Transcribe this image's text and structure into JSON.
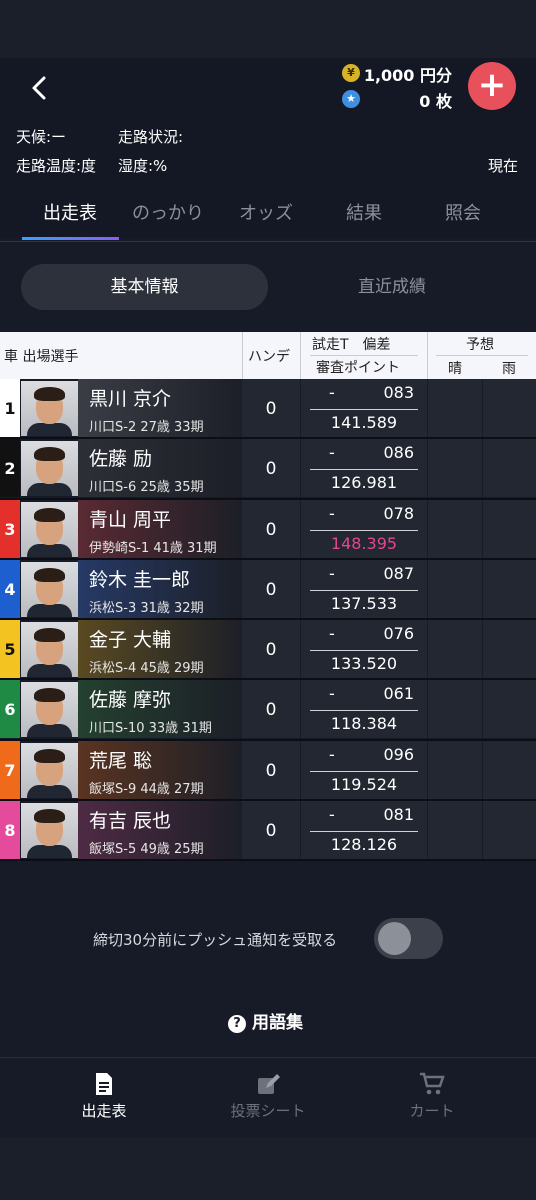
{
  "header": {
    "coin_symbol": "¥",
    "coin_text": "1,000 円分",
    "ticket_text": "0 枚",
    "add_label": "+",
    "back_label": "‹"
  },
  "info": {
    "weather": "天候:ー",
    "track_state": "走路状況:",
    "track_temp": "走路温度:度",
    "humidity": "湿度:%",
    "now": "現在"
  },
  "tabs": [
    "出走表",
    "のっかり",
    "オッズ",
    "結果",
    "照会"
  ],
  "segments": [
    "基本情報",
    "直近成績"
  ],
  "table": {
    "col_rider": "車 出場選手",
    "col_hande": "ハンデ",
    "col_trial_top": "試走T　偏差",
    "col_trial_bottom": "審査ポイント",
    "col_pred": "予想",
    "col_pred_sunny": "晴",
    "col_pred_rain": "雨",
    "rows": [
      {
        "no": "1",
        "name": "黒川 京介",
        "meta": "川口S-2 27歳 33期",
        "hande": "0",
        "trial": "-",
        "dev": "083",
        "points": "141.589",
        "points_color": "#ffffff"
      },
      {
        "no": "2",
        "name": "佐藤 励",
        "meta": "川口S-6 25歳 35期",
        "hande": "0",
        "trial": "-",
        "dev": "086",
        "points": "126.981",
        "points_color": "#ffffff"
      },
      {
        "no": "3",
        "name": "青山 周平",
        "meta": "伊勢崎S-1 41歳 31期",
        "hande": "0",
        "trial": "-",
        "dev": "078",
        "points": "148.395",
        "points_color": "#e3468f"
      },
      {
        "no": "4",
        "name": "鈴木 圭一郎",
        "meta": "浜松S-3 31歳 32期",
        "hande": "0",
        "trial": "-",
        "dev": "087",
        "points": "137.533",
        "points_color": "#ffffff"
      },
      {
        "no": "5",
        "name": "金子 大輔",
        "meta": "浜松S-4 45歳 29期",
        "hande": "0",
        "trial": "-",
        "dev": "076",
        "points": "133.520",
        "points_color": "#ffffff"
      },
      {
        "no": "6",
        "name": "佐藤 摩弥",
        "meta": "川口S-10 33歳 31期",
        "hande": "0",
        "trial": "-",
        "dev": "061",
        "points": "118.384",
        "points_color": "#ffffff"
      },
      {
        "no": "7",
        "name": "荒尾 聡",
        "meta": "飯塚S-9 44歳 27期",
        "hande": "0",
        "trial": "-",
        "dev": "096",
        "points": "119.524",
        "points_color": "#ffffff"
      },
      {
        "no": "8",
        "name": "有吉 辰也",
        "meta": "飯塚S-5 49歳 25期",
        "hande": "0",
        "trial": "-",
        "dev": "081",
        "points": "128.126",
        "points_color": "#ffffff"
      }
    ]
  },
  "car_colors": [
    {
      "bg": "#ffffff",
      "fg": "#111111"
    },
    {
      "bg": "#111111",
      "fg": "#ffffff"
    },
    {
      "bg": "#e4302a",
      "fg": "#ffffff"
    },
    {
      "bg": "#1e5fd0",
      "fg": "#ffffff"
    },
    {
      "bg": "#f2c321",
      "fg": "#111111"
    },
    {
      "bg": "#1f8a44",
      "fg": "#ffffff"
    },
    {
      "bg": "#ef6a1b",
      "fg": "#ffffff"
    },
    {
      "bg": "#e54b9b",
      "fg": "#ffffff"
    }
  ],
  "row_tints": [
    "#3a3d45",
    "#2c2f36",
    "#5a2a33",
    "#263a66",
    "#5a4a22",
    "#24402f",
    "#5a3421",
    "#4e2a44"
  ],
  "push": {
    "label": "締切30分前にプッシュ通知を受取る",
    "enabled": false
  },
  "glossary": {
    "label": "用語集",
    "icon": "?"
  },
  "bottom_nav": [
    {
      "label": "出走表",
      "icon": "document-icon",
      "active": true
    },
    {
      "label": "投票シート",
      "icon": "pencil-icon",
      "active": false
    },
    {
      "label": "カート",
      "icon": "cart-icon",
      "active": false
    }
  ]
}
